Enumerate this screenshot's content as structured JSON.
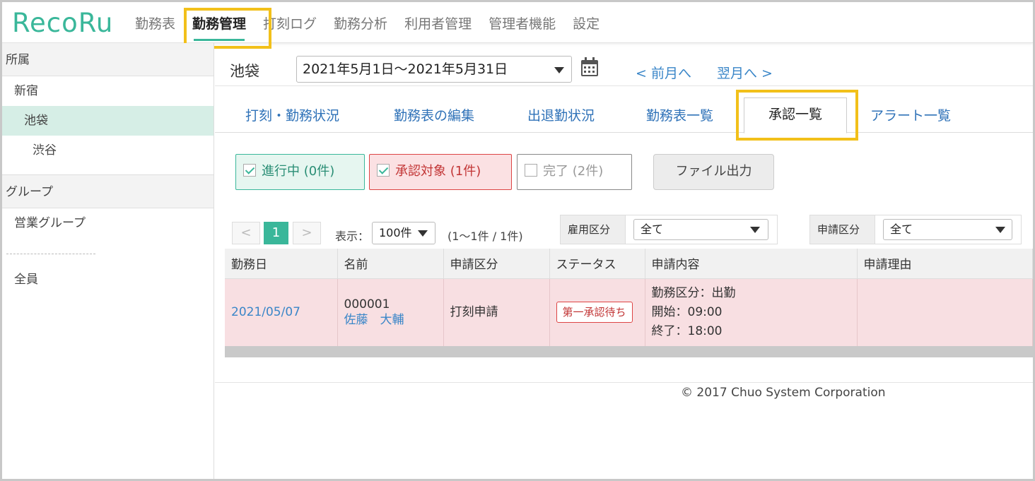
{
  "header": {
    "logo": "RecoRu",
    "nav": [
      "勤務表",
      "勤務管理",
      "打刻ログ",
      "勤務分析",
      "利用者管理",
      "管理者機能",
      "設定"
    ],
    "active_nav": "勤務管理"
  },
  "sidebar": {
    "section_affiliation": "所属",
    "affiliations": [
      "新宿",
      "池袋",
      "渋谷"
    ],
    "active_affiliation": "池袋",
    "section_group": "グループ",
    "groups": [
      "営業グループ"
    ],
    "dashes": "----------------",
    "all_label": "全員"
  },
  "main": {
    "location": "池袋",
    "date_range": "2021年5月1日～2021年5月31日",
    "prev_month": "< 前月へ",
    "next_month": "翌月へ >",
    "tabs": [
      "打刻・勤務状況",
      "勤務表の編集",
      "出退勤状況",
      "勤務表一覧",
      "承認一覧",
      "アラート一覧"
    ],
    "active_tab": "承認一覧",
    "filters": [
      {
        "label": "進行中 (0件)",
        "checked": true
      },
      {
        "label": "承認対象 (1件)",
        "checked": true
      },
      {
        "label": "完了 (2件)",
        "checked": false
      }
    ],
    "file_output": "ファイル出力",
    "pager": {
      "prev": "<",
      "current": "1",
      "next": ">"
    },
    "display_label": "表示：",
    "display_value": "100件",
    "count_text": "(1～1件 / 1件)",
    "employment_label": "雇用区分",
    "employment_value": "全て",
    "request_type_label": "申請区分",
    "request_type_value": "全て",
    "table": {
      "headers": [
        "勤務日",
        "名前",
        "申請区分",
        "ステータス",
        "申請内容",
        "申請理由"
      ],
      "rows": [
        {
          "date": "2021/05/07",
          "employee_id": "000001",
          "employee_name": "佐藤　大輔",
          "request_type": "打刻申請",
          "status": "第一承認待ち",
          "content_1": "勤務区分：出勤",
          "content_2": "開始：09:00",
          "content_3": "終了：18:00",
          "reason": ""
        }
      ]
    },
    "copyright": "© 2017 Chuo System Corporation"
  },
  "colors": {
    "accent": "#3ab79a",
    "highlight": "#f2c01a",
    "link": "#3a86c8",
    "alert_row": "#f8dfe2"
  }
}
